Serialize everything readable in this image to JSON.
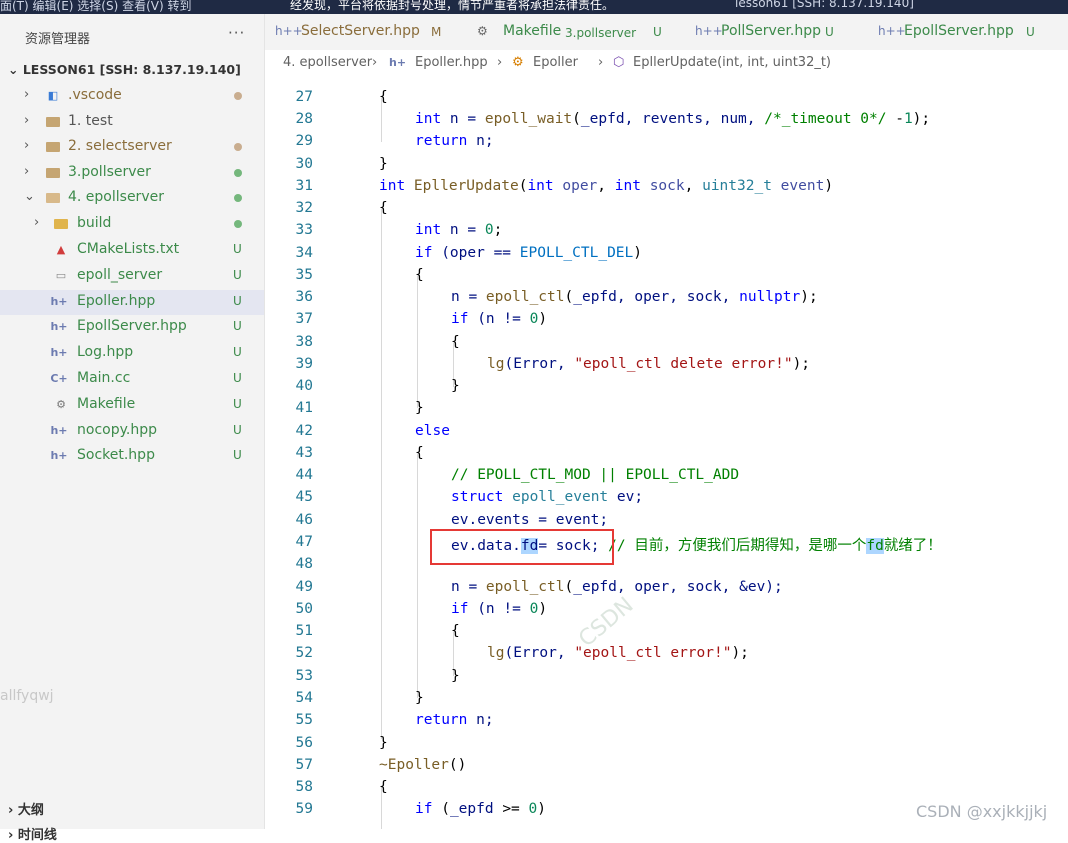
{
  "topbar": {
    "menu": "面(T)    编辑(E)    选择(S)    查看(V)    转到",
    "notice": "经发现，平台将依据封号处理，情节严重者将承担法律责任。",
    "window_title": "lesson61 [SSH: 8.137.19.140]"
  },
  "sidebar": {
    "title": "资源管理器",
    "more": "···",
    "project": "LESSON61 [SSH: 8.137.19.140]",
    "items": [
      {
        "label": ".vscode",
        "status": "",
        "dot_color": "#c9ad8f"
      },
      {
        "label": "1. test",
        "status": ""
      },
      {
        "label": "2. selectserver",
        "status": "",
        "dot_color": "#c9ad8f"
      },
      {
        "label": "3.pollserver",
        "status": "",
        "dot_color": "#74b77c"
      },
      {
        "label": "4. epollserver",
        "status": "",
        "dot_color": "#74b77c"
      },
      {
        "label": "build",
        "status": "",
        "dot_color": "#74b77c"
      },
      {
        "label": "CMakeLists.txt",
        "status": "U"
      },
      {
        "label": "epoll_server",
        "status": "U"
      },
      {
        "label": "Epoller.hpp",
        "status": "U"
      },
      {
        "label": "EpollServer.hpp",
        "status": "U"
      },
      {
        "label": "Log.hpp",
        "status": "U"
      },
      {
        "label": "Main.cc",
        "status": "U"
      },
      {
        "label": "Makefile",
        "status": "U"
      },
      {
        "label": "nocopy.hpp",
        "status": "U"
      },
      {
        "label": "Socket.hpp",
        "status": "U"
      }
    ],
    "watermark": "allfyqwj",
    "outline": "大纲",
    "timeline": "时间线"
  },
  "tabs": [
    {
      "label": "SelectServer.hpp",
      "status": "M",
      "icon": "h++"
    },
    {
      "label": "Makefile",
      "extra": "3.pollserver",
      "status": "U",
      "icon": "makefile-icon"
    },
    {
      "label": "PollServer.hpp",
      "status": "U",
      "icon": "h++"
    },
    {
      "label": "EpollServer.hpp",
      "status": "U",
      "icon": "h++"
    }
  ],
  "breadcrumb": {
    "folder": "4. epollserver",
    "file": "Epoller.hpp",
    "class": "Epoller",
    "method": "EpllerUpdate(int, int, uint32_t)"
  },
  "editor": {
    "lines": [
      {
        "num": "27"
      },
      {
        "num": "28"
      },
      {
        "num": "29"
      },
      {
        "num": "30"
      },
      {
        "num": "31"
      },
      {
        "num": "32"
      },
      {
        "num": "33"
      },
      {
        "num": "34"
      },
      {
        "num": "35"
      },
      {
        "num": "36"
      },
      {
        "num": "37"
      },
      {
        "num": "38"
      },
      {
        "num": "39"
      },
      {
        "num": "40"
      },
      {
        "num": "41"
      },
      {
        "num": "42"
      },
      {
        "num": "43"
      },
      {
        "num": "44"
      },
      {
        "num": "45"
      },
      {
        "num": "46"
      },
      {
        "num": "47"
      },
      {
        "num": "48"
      },
      {
        "num": "49"
      },
      {
        "num": "50"
      },
      {
        "num": "51"
      },
      {
        "num": "52"
      },
      {
        "num": "53"
      },
      {
        "num": "54"
      },
      {
        "num": "55"
      },
      {
        "num": "56"
      },
      {
        "num": "57"
      },
      {
        "num": "58"
      },
      {
        "num": "59"
      }
    ],
    "tokens": {
      "brace_open": "{",
      "brace_close": "}",
      "l28_int": "int",
      "l28_n": " n = ",
      "l28_fn": "epoll_wait",
      "l28_args1": "(",
      "l28_epfd": "_epfd",
      "l28_args2": ", revents, num, ",
      "l28_comment": "/*_timeout 0*/",
      "l28_neg": " -",
      "l28_one": "1",
      "l28_end": ");",
      "l29_return": "return",
      "l29_rest": " n;",
      "l31_int": "int",
      "l31_fn": " EpllerUpdate",
      "l31_p1": "(",
      "l31_int2": "int",
      "l31_oper": " oper",
      "l31_c1": ", ",
      "l31_int3": "int",
      "l31_sock": " sock",
      "l31_c2": ", ",
      "l31_u32": "uint32_t",
      "l31_event": " event",
      "l31_p2": ")",
      "l33_int": "int",
      "l33_n": " n = ",
      "l33_zero": "0",
      "l33_end": ";",
      "l34_if": "if",
      "l34_a": " (oper == ",
      "l34_m": "EPOLL_CTL_DEL",
      "l34_b": ")",
      "l36_a": "n = ",
      "l36_fn": "epoll_ctl",
      "l36_b": "(",
      "l36_epfd": "_epfd",
      "l36_c": ", oper, sock, ",
      "l36_null": "nullptr",
      "l36_d": ");",
      "l37_if": "if",
      "l37_a": " (n != ",
      "l37_zero": "0",
      "l37_b": ")",
      "l39_fn": "lg",
      "l39_a": "(Error, ",
      "l39_s": "\"epoll_ctl delete error!\"",
      "l39_b": ");",
      "l42_else": "else",
      "l44_comment": "// EPOLL_CTL_MOD || EPOLL_CTL_ADD",
      "l45_struct": "struct",
      "l45_type": " epoll_event",
      "l45_rest": " ev;",
      "l46": "ev.events = event;",
      "l47_a": "ev.data.",
      "l47_fd": "fd",
      "l47_b": "= sock;",
      "l47_comment": " // 目前，方便我们后期得知，是哪一个",
      "l47_fd2": "fd",
      "l47_comment2": "就绪了！",
      "l49_a": "n = ",
      "l49_fn": "epoll_ctl",
      "l49_b": "(",
      "l49_epfd": "_epfd",
      "l49_c": ", oper, sock, &ev);",
      "l50_if": "if",
      "l50_a": " (n != ",
      "l50_zero": "0",
      "l50_b": ")",
      "l52_fn": "lg",
      "l52_a": "(Error, ",
      "l52_s": "\"epoll_ctl error!\"",
      "l52_b": ");",
      "l55_return": "return",
      "l55_rest": " n;",
      "l57_fn": "~Epoller",
      "l57_rest": "()",
      "l59_if": "if",
      "l59_a": " (",
      "l59_epfd": "_epfd",
      "l59_b": " >= ",
      "l59_zero": "0",
      "l59_c": ")"
    }
  },
  "watermark_center": "CSDN",
  "csdn_watermark": "CSDN @xxjkkjjkj"
}
